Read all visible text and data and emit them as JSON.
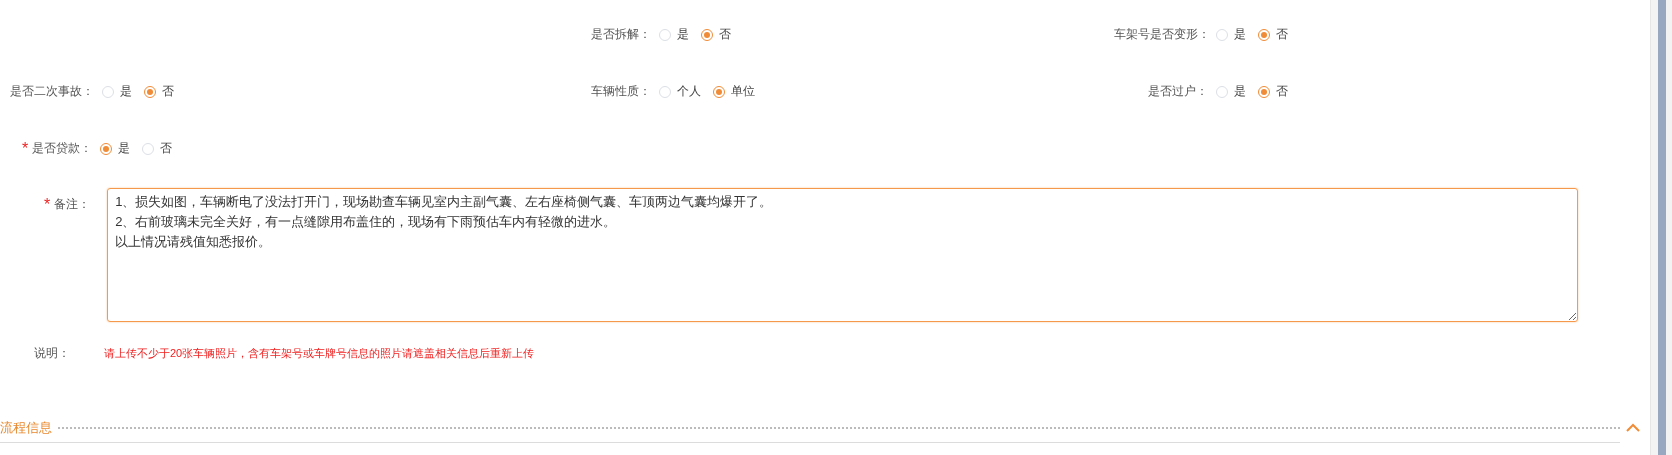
{
  "fields": [
    [
      {
        "label": "是否拆解：",
        "options": [
          {
            "label": "是",
            "selected": false
          },
          {
            "label": "否",
            "selected": true
          }
        ]
      },
      {
        "label": "车架号是否变形：",
        "options": [
          {
            "label": "是",
            "selected": false
          },
          {
            "label": "否",
            "selected": true
          }
        ]
      }
    ],
    [
      {
        "label": "是否二次事故：",
        "options": [
          {
            "label": "是",
            "selected": false
          },
          {
            "label": "否",
            "selected": true
          }
        ]
      },
      {
        "label": "车辆性质：",
        "options": [
          {
            "label": "个人",
            "selected": false
          },
          {
            "label": "单位",
            "selected": true
          }
        ]
      },
      {
        "label": "是否过户：",
        "options": [
          {
            "label": "是",
            "selected": false
          },
          {
            "label": "否",
            "selected": true
          }
        ]
      }
    ],
    [
      {
        "label": "是否贷款：",
        "required_mark": "*",
        "options": [
          {
            "label": "是",
            "selected": true
          },
          {
            "label": "否",
            "selected": false
          }
        ]
      }
    ]
  ],
  "remarks": {
    "label": "备注：",
    "required_mark": "*",
    "lines": [
      "1、损失如图，车辆断电了没法打开门，现场勘查车辆见室内主副气囊、左右座椅侧气囊、车顶两边气囊均爆开了。",
      "2、右前玻璃未完全关好，有一点缝隙用布盖住的，现场有下雨预估车内有轻微的进水。",
      "以上情况请残值知悉报价。"
    ]
  },
  "note": {
    "label": "说明：",
    "text": "请上传不少于20张车辆照片，含有车架号或车牌号信息的照片请遮盖相关信息后重新上传"
  },
  "section": {
    "title": "流程信息",
    "expanded": true
  }
}
